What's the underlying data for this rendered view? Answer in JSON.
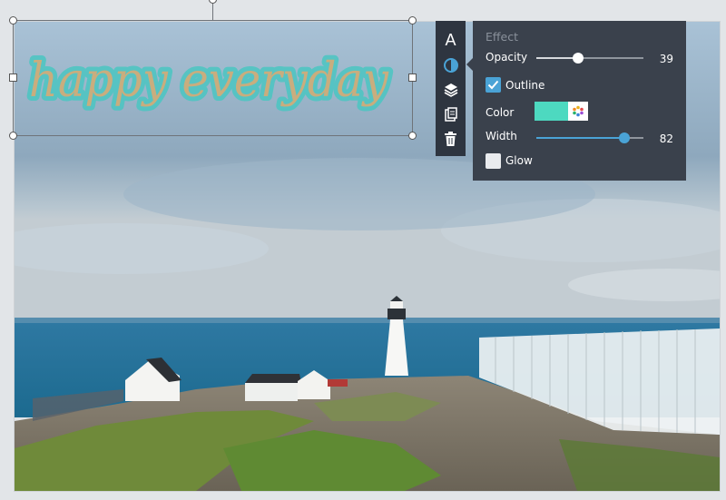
{
  "canvas": {
    "text_content": "happy everyday",
    "text_color": "#c9ad7e",
    "outline_color": "#4bc6c2"
  },
  "toolbar": {
    "tools": [
      {
        "name": "text",
        "glyph": "A"
      },
      {
        "name": "effect",
        "icon": "half-circle-icon",
        "active": true
      },
      {
        "name": "layers",
        "icon": "layers-icon"
      },
      {
        "name": "duplicate",
        "icon": "copy-icon"
      },
      {
        "name": "delete",
        "icon": "trash-icon"
      }
    ]
  },
  "effect_panel": {
    "title": "Effect",
    "opacity": {
      "label": "Opacity",
      "value": "39",
      "fraction": 0.39
    },
    "outline": {
      "label": "Outline",
      "checked": true
    },
    "color": {
      "label": "Color",
      "value": "#4dd9c0",
      "picker_icon": "color-wheel-icon"
    },
    "width": {
      "label": "Width",
      "value": "82",
      "fraction": 0.82
    },
    "glow": {
      "label": "Glow",
      "checked": false
    }
  },
  "colors": {
    "panel_bg": "#3a414c",
    "toolbar_bg": "#2e3540",
    "accent": "#4aa3d6"
  }
}
